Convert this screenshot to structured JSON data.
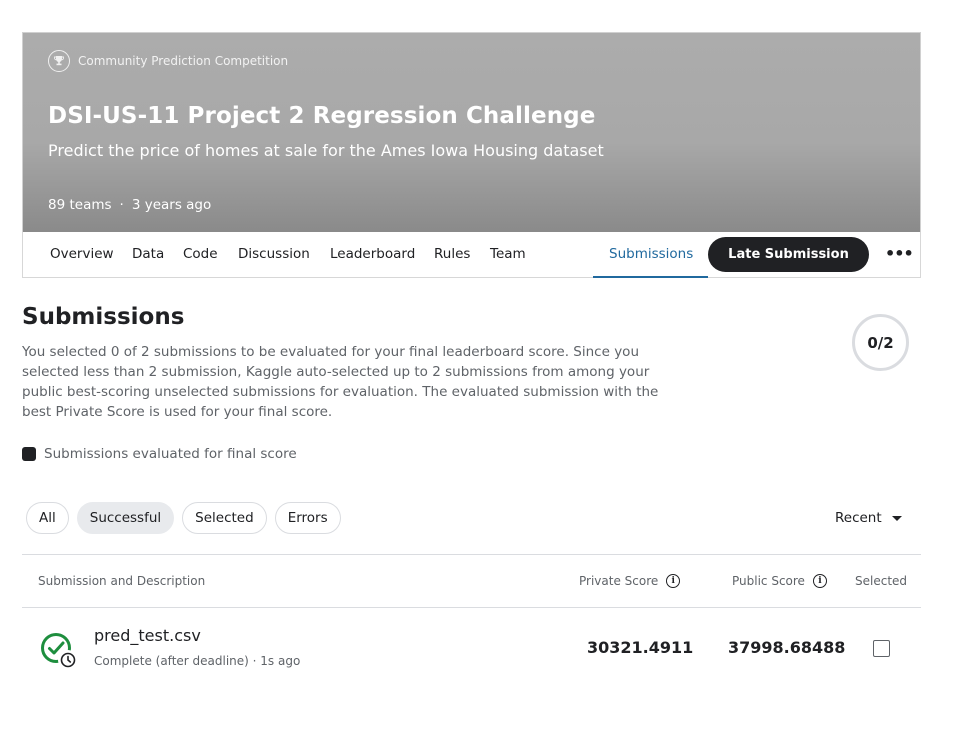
{
  "banner": {
    "type_label": "Community Prediction Competition",
    "title": "DSI-US-11 Project 2 Regression Challenge",
    "subtitle": "Predict the price of homes at sale for the Ames Iowa Housing dataset",
    "teams": "89 teams",
    "separator": "·",
    "age": "3 years ago"
  },
  "tabs": [
    {
      "label": "Overview"
    },
    {
      "label": "Data"
    },
    {
      "label": "Code"
    },
    {
      "label": "Discussion"
    },
    {
      "label": "Leaderboard"
    },
    {
      "label": "Rules"
    },
    {
      "label": "Team"
    },
    {
      "label": "Submissions",
      "active": true
    }
  ],
  "late_submission_label": "Late Submission",
  "more_label": "•••",
  "submissions": {
    "title": "Submissions",
    "description": "You selected 0 of 2 submissions to be evaluated for your final leaderboard score. Since you selected less than 2 submission, Kaggle auto-selected up to 2 submissions from among your public best-scoring unselected submissions for evaluation. The evaluated submission with the best Private Score is used for your final score.",
    "selected_count": "0/2",
    "legend_label": "Submissions evaluated for final score"
  },
  "filters": [
    {
      "label": "All"
    },
    {
      "label": "Successful",
      "active": true
    },
    {
      "label": "Selected"
    },
    {
      "label": "Errors"
    }
  ],
  "sort_label": "Recent",
  "table": {
    "headers": {
      "description": "Submission and Description",
      "private": "Private Score",
      "public": "Public Score",
      "selected": "Selected"
    },
    "rows": [
      {
        "file": "pred_test.csv",
        "status": "Complete (after deadline) · 1s ago",
        "private_score": "30321.4911",
        "public_score": "37998.68488",
        "selected": false
      }
    ]
  },
  "colors": {
    "accent": "#20699e",
    "success": "#1e8e3e",
    "dark": "#202124"
  }
}
